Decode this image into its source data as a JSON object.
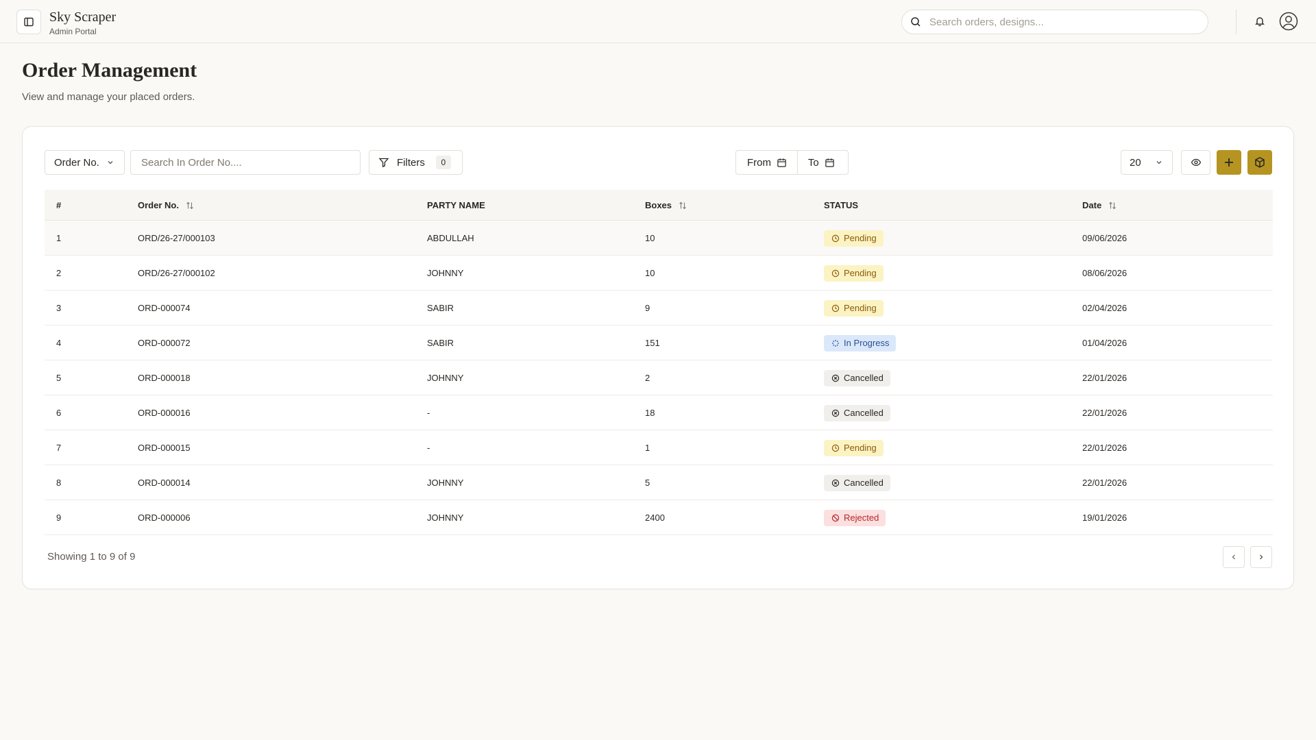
{
  "header": {
    "app_title": "Sky Scraper",
    "app_subtitle": "Admin Portal",
    "search_placeholder": "Search orders, designs..."
  },
  "page": {
    "title": "Order Management",
    "subtitle": "View and manage your placed orders."
  },
  "toolbar": {
    "search_field": "Order No.",
    "search_placeholder": "Search In Order No....",
    "filters_label": "Filters",
    "filters_count": "0",
    "date_from": "From",
    "date_to": "To",
    "page_size": "20"
  },
  "table": {
    "columns": [
      "#",
      "Order No.",
      "PARTY NAME",
      "Boxes",
      "STATUS",
      "Date"
    ],
    "rows": [
      {
        "index": "1",
        "order_no": "ORD/26-27/000103",
        "party": "ABDULLAH",
        "boxes": "10",
        "status": "Pending",
        "date": "09/06/2026"
      },
      {
        "index": "2",
        "order_no": "ORD/26-27/000102",
        "party": "JOHNNY",
        "boxes": "10",
        "status": "Pending",
        "date": "08/06/2026"
      },
      {
        "index": "3",
        "order_no": "ORD-000074",
        "party": "SABIR",
        "boxes": "9",
        "status": "Pending",
        "date": "02/04/2026"
      },
      {
        "index": "4",
        "order_no": "ORD-000072",
        "party": "SABIR",
        "boxes": "151",
        "status": "In Progress",
        "date": "01/04/2026"
      },
      {
        "index": "5",
        "order_no": "ORD-000018",
        "party": "JOHNNY",
        "boxes": "2",
        "status": "Cancelled",
        "date": "22/01/2026"
      },
      {
        "index": "6",
        "order_no": "ORD-000016",
        "party": "-",
        "boxes": "18",
        "status": "Cancelled",
        "date": "22/01/2026"
      },
      {
        "index": "7",
        "order_no": "ORD-000015",
        "party": "-",
        "boxes": "1",
        "status": "Pending",
        "date": "22/01/2026"
      },
      {
        "index": "8",
        "order_no": "ORD-000014",
        "party": "JOHNNY",
        "boxes": "5",
        "status": "Cancelled",
        "date": "22/01/2026"
      },
      {
        "index": "9",
        "order_no": "ORD-000006",
        "party": "JOHNNY",
        "boxes": "2400",
        "status": "Rejected",
        "date": "19/01/2026"
      }
    ]
  },
  "footer": {
    "showing": "Showing 1 to 9 of 9"
  },
  "colors": {
    "accent": "#b59422",
    "pending_bg": "#fbf3c3",
    "progress_bg": "#dbe8fa",
    "cancelled_bg": "#f1efeb",
    "rejected_bg": "#fcdfdf"
  },
  "icons": {
    "sidebar_toggle": "panel-left-icon",
    "search": "search-icon",
    "notifications": "bell-icon",
    "profile": "user-circle-icon",
    "filter": "filter-icon",
    "calendar": "calendar-icon",
    "view": "eye-icon",
    "add": "plus-icon",
    "box": "box-icon",
    "sort": "sort-icon",
    "prev": "chevron-left-icon",
    "next": "chevron-right-icon"
  }
}
